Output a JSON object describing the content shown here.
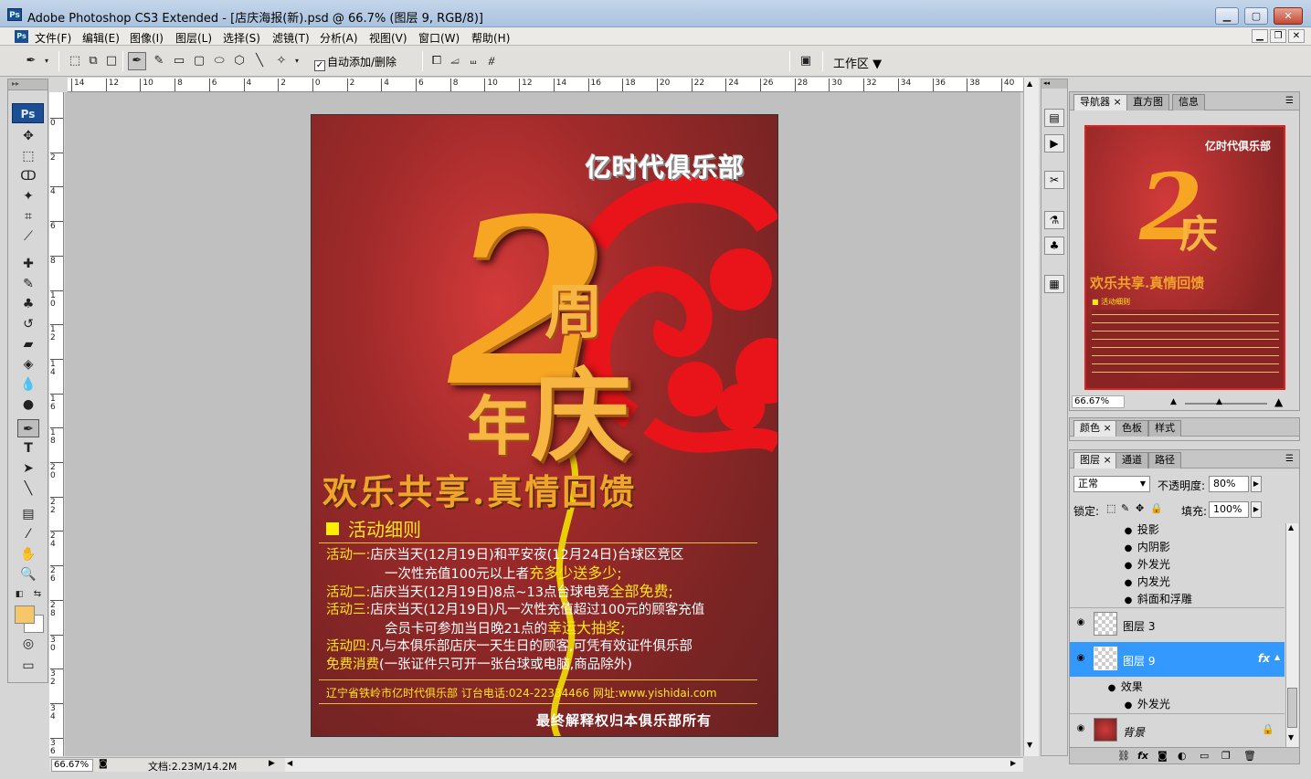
{
  "window": {
    "title": "Adobe Photoshop CS3 Extended - [店庆海报(新).psd @ 66.7% (图层 9, RGB/8)]",
    "app_icon": "Ps"
  },
  "menu": [
    "文件(F)",
    "编辑(E)",
    "图像(I)",
    "图层(L)",
    "选择(S)",
    "滤镜(T)",
    "分析(A)",
    "视图(V)",
    "窗口(W)",
    "帮助(H)"
  ],
  "options": {
    "auto_add_label": "自动添加/删除",
    "auto_add_checked": true,
    "workspace_label": "工作区"
  },
  "ruler_h": [
    "14",
    "12",
    "10",
    "8",
    "6",
    "4",
    "2",
    "0",
    "2",
    "4",
    "6",
    "8",
    "10",
    "12",
    "14",
    "16",
    "18",
    "20",
    "22",
    "24",
    "26",
    "28",
    "30",
    "32",
    "34",
    "36",
    "38",
    "40"
  ],
  "ruler_v": [
    "0",
    "2",
    "4",
    "6",
    "8",
    "1 0",
    "1 2",
    "1 4",
    "1 6",
    "1 8",
    "2 0",
    "2 2",
    "2 4",
    "2 6",
    "2 8",
    "3 0",
    "3 2",
    "3 4",
    "3 6"
  ],
  "poster": {
    "club": "亿时代俱乐部",
    "big2": "2",
    "zhou": "周",
    "nian": "年",
    "qing": "庆",
    "slogan": "欢乐共享.真情回馈",
    "detail_title": "活动细则",
    "a1_label": "活动一:",
    "a1_text": "店庆当天(12月19日)和平安夜(12月24日)台球区竞区",
    "a1_text2": "一次性充值100元以上者",
    "a1_hl": "充多少送多少;",
    "a2_label": "活动二:",
    "a2_text": "店庆当天(12月19日)8点~13点台球电竞",
    "a2_hl": "全部免费;",
    "a3_label": "活动三:",
    "a3_text": "店庆当天(12月19日)凡一次性充值超过100元的顾客充值",
    "a3_text2": "会员卡可参加当日晚21点的",
    "a3_hl": "幸运大抽奖;",
    "a4_label": "活动四:",
    "a4_text": "凡与本俱乐部店庆一天生日的顾客,可凭有效证件俱乐部",
    "a4_hl": "免费消费",
    "a4_text2": "(一张证件只可开一张台球或电脑,商品除外)",
    "contact": "辽宁省铁岭市亿时代俱乐部 订台电话:024-22334466 网址:www.yishidai.com",
    "rights": "最终解释权归本俱乐部所有"
  },
  "status": {
    "zoom": "66.67%",
    "doc": "文档:2.23M/14.2M"
  },
  "navigator": {
    "tabs": [
      "导航器",
      "直方图",
      "信息"
    ],
    "zoom": "66.67%",
    "thumb_club": "亿时代俱乐部",
    "thumb_2": "2",
    "thumb_qing": "庆",
    "thumb_slogan": "欢乐共享.真情回馈",
    "thumb_detail": "■ 活动细则"
  },
  "color_panel": {
    "tabs": [
      "颜色",
      "色板",
      "样式"
    ]
  },
  "layers": {
    "tabs": [
      "图层",
      "通道",
      "路径"
    ],
    "blend_mode": "正常",
    "opacity_label": "不透明度:",
    "opacity": "80%",
    "lock_label": "锁定:",
    "fill_label": "填充:",
    "fill": "100%",
    "effects_top": [
      "投影",
      "内阴影",
      "外发光",
      "内发光",
      "斜面和浮雕"
    ],
    "layer3": "图层 3",
    "layer9": "图层 9",
    "effect_label": "效果",
    "outer_glow": "外发光",
    "background": "背景"
  },
  "colors": {
    "accent": "#3399ff",
    "foreground": "#f5c66a",
    "background": "#ffffff"
  }
}
